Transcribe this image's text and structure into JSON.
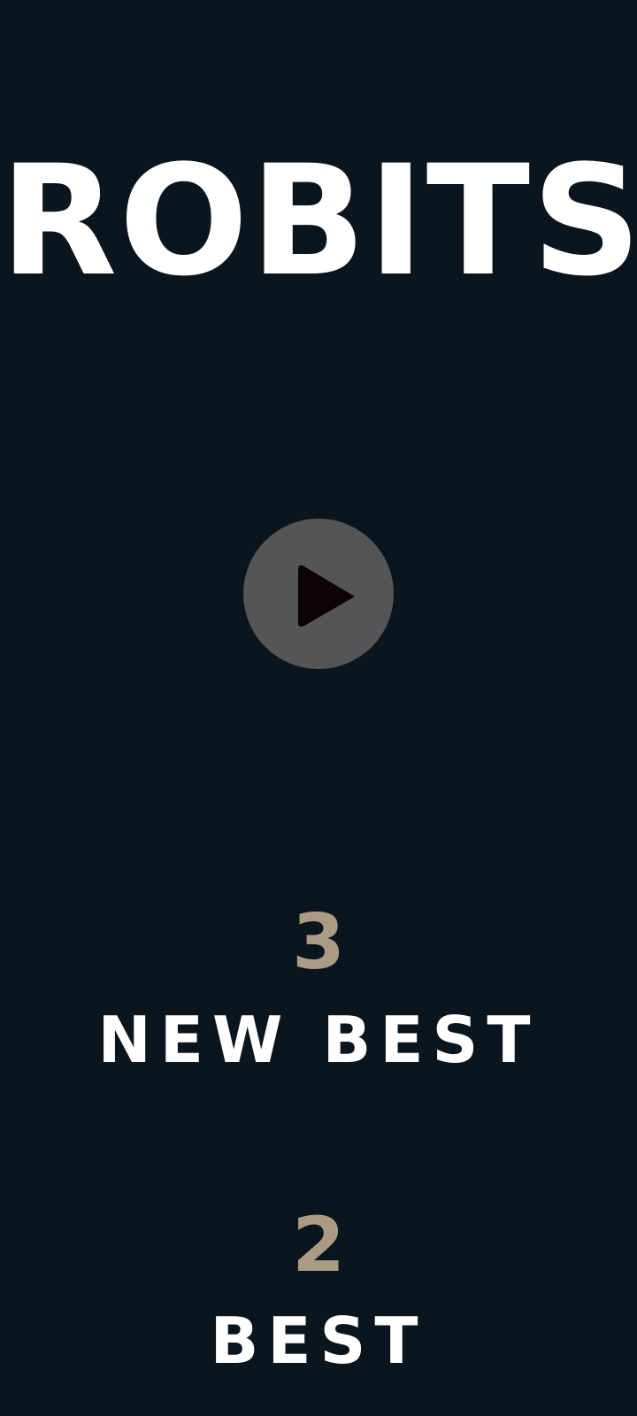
{
  "game": {
    "title": "ROBITS"
  },
  "play_button": {
    "icon": "play-icon",
    "color": "#545556",
    "icon_color": "#0e0304"
  },
  "scores": {
    "current_score": "3",
    "current_label": "NEW BEST",
    "best_score": "2",
    "best_label": "BEST"
  },
  "colors": {
    "background": "#0b151d",
    "score_value": "#a99c83",
    "text": "#ffffff"
  }
}
